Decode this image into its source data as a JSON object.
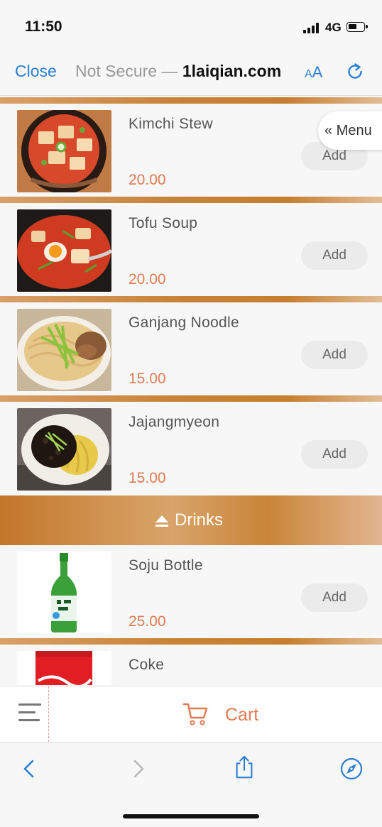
{
  "status_bar": {
    "time": "11:50",
    "network": "4G"
  },
  "browser": {
    "close_label": "Close",
    "not_secure": "Not Secure — ",
    "domain": "1laiqian.com",
    "aa_small": "A",
    "aa_large": "A"
  },
  "menu_tab_label": "« Menu",
  "items": [
    {
      "name": "Kimchi Stew",
      "price": "20.00",
      "add_label": "Add"
    },
    {
      "name": "Tofu Soup",
      "price": "20.00",
      "add_label": "Add"
    },
    {
      "name": "Ganjang Noodle",
      "price": "15.00",
      "add_label": "Add"
    },
    {
      "name": "Jajangmyeon",
      "price": "15.00",
      "add_label": "Add"
    },
    {
      "name": "Soju Bottle",
      "price": "25.00",
      "add_label": "Add"
    },
    {
      "name": "Coke"
    }
  ],
  "category": {
    "name": "Drinks"
  },
  "cart": {
    "label": "Cart"
  },
  "colors": {
    "accent": "#e07a52",
    "link": "#2a7fd4",
    "band": "#c88338"
  }
}
